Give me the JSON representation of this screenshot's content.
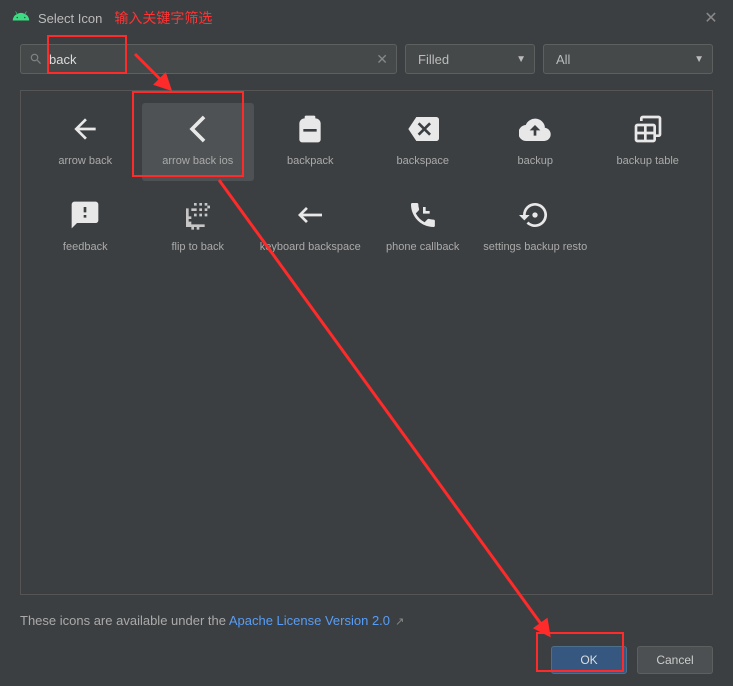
{
  "titlebar": {
    "title": "Select Icon",
    "annotation": "输入关键字筛选"
  },
  "filters": {
    "search_value": "back",
    "style_selected": "Filled",
    "category_selected": "All"
  },
  "icons": [
    {
      "name": "arrow back",
      "svg": "<path d='M20 11H7.83l5.59-5.59L12 4l-8 8 8 8 1.41-1.41L7.83 13H20z'/>"
    },
    {
      "name": "arrow back ios",
      "selected": true,
      "svg": "<path d='M17.5 3.9L15.6 2 5.6 12l10 10 1.9-1.9L9.4 12z'/>"
    },
    {
      "name": "backpack",
      "svg": "<path d='M20 8v12a2 2 0 01-2 2H6a2 2 0 01-2-2V8a4 4 0 014-4V3a1 1 0 011-1h6a1 1 0 011 1v1a4 4 0 014 4zM7 14h10v-2H7z'/>"
    },
    {
      "name": "backspace",
      "svg": "<path d='M22 3H7L1 12l6 9h15a2 2 0 002-2V5a2 2 0 00-2-2zm-4 12.6L16.6 17 13 13.4 9.4 17 8 15.6 11.6 12 8 8.4 9.4 7 13 10.6 16.6 7 18 8.4 14.4 12z'/>"
    },
    {
      "name": "backup",
      "svg": "<path d='M19.35 10.04A7.5 7.5 0 005.05 9.02 6 6 0 006 21h13a5 5 0 00.35-9.96zM13 13v4h-2v-4H8l4-4 4 4z'/>"
    },
    {
      "name": "backup table",
      "svg": "<path d='M20 2H8a2 2 0 00-2 2v2h2V4h12v12h-2v2h2a2 2 0 002-2V4a2 2 0 00-2-2zM4 8h12a2 2 0 012 2v10a2 2 0 01-2 2H4a2 2 0 01-2-2V10a2 2 0 012-2zm0 2v4h5v-4zm7 0v4h5v-4zm-7 6v4h5v-4zm7 0v4h5v-4z'/>"
    },
    {
      "name": "feedback",
      "svg": "<path d='M20 2H4a2 2 0 00-2 2v18l4-4h14a2 2 0 002-2V4a2 2 0 00-2-2zm-7 12h-2v-2h2zm0-4h-2V6h2z'/>"
    },
    {
      "name": "flip to back",
      "svg": "<path d='M9 7h2v2H9zm0 4h2v2H9zm-2-4h2v2H7zM5 17h2v2H5zm0-4h2v2H5zm2 8h2v2H7zm4 0h2v2h-2zm8-16h2v2h-2zM9 3h2v2H9zm4 0h2v2h-2zm4 0h2v2h-2zm-4 4h2v2h-2zm4 0h2v2h-2zm0 4h2v2h-2zm-4 0h2v2h-2zM3 7v14h14v-2H5V7z' opacity='.8'/>"
    },
    {
      "name": "keyboard backspace",
      "svg": "<path d='M21 11H6.83l3.58-3.59L9 6l-6 6 6 6 1.41-1.41L6.83 13H21z'/>"
    },
    {
      "name": "phone callback",
      "svg": "<path d='M6.6 10.8a15 15 0 006.6 6.6l2.2-2.2a1 1 0 011-.25 11 11 0 003.5.56 1 1 0 011 1V20a1 1 0 01-1 1A17 17 0 013 4a1 1 0 011-1h3.5a1 1 0 011 1 11 11 0 00.56 3.5 1 1 0 01-.25 1zM19 4l-5 5h3v2h-5V6h2v3z'/>"
    },
    {
      "name": "settings backup resto",
      "svg": "<path d='M14 12a2 2 0 11-4 0 2 2 0 014 0zm-2-9a9 9 0 00-9 9H0l4 4 4-4H5a7 7 0 112.05 4.95l-1.4 1.4A9 9 0 1012 3z'/>"
    }
  ],
  "footer": {
    "prefix": "These icons are available under the ",
    "link_text": "Apache License Version 2.0"
  },
  "buttons": {
    "ok": "OK",
    "cancel": "Cancel"
  }
}
